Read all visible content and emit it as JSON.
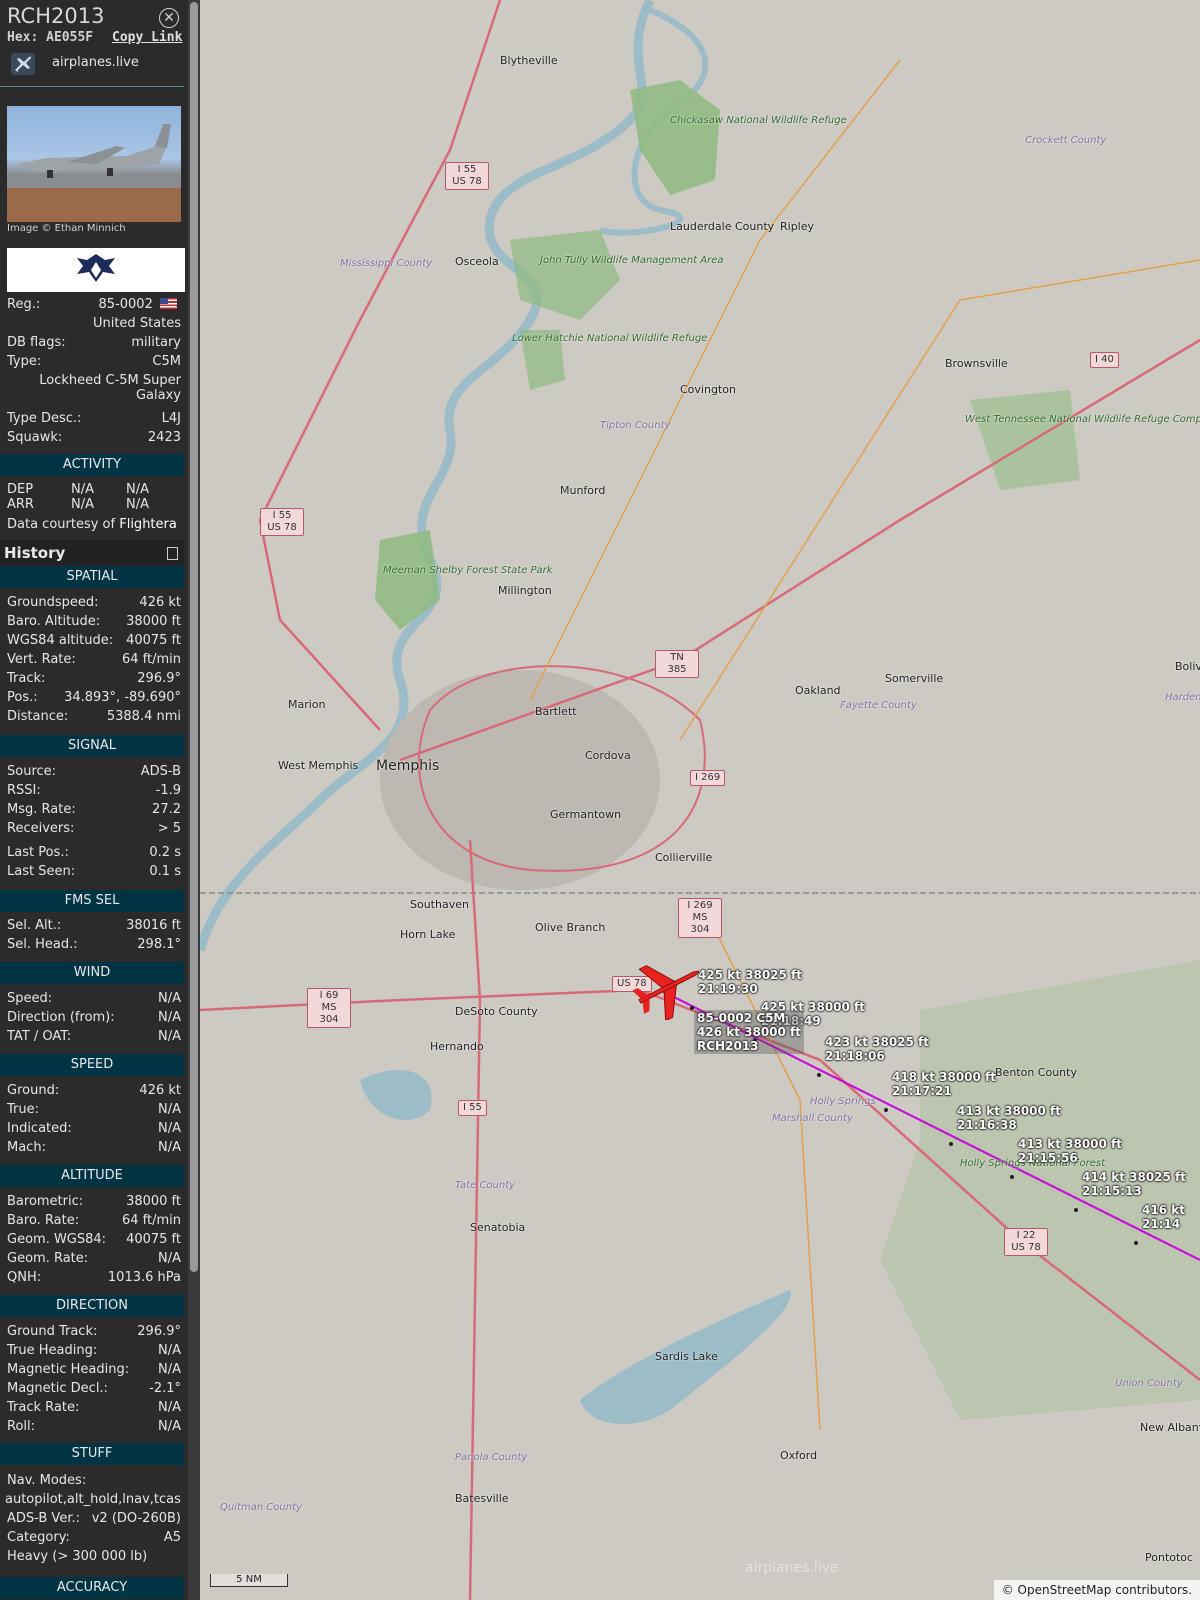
{
  "header": {
    "callsign": "RCH2013",
    "hex": "Hex: AE055F",
    "copy_link": "Copy Link",
    "site": "airplanes.live",
    "photo_credit": "Image © Ethan Minnich"
  },
  "aircraft": {
    "reg_label": "Reg.:",
    "reg_value": "85-0002",
    "country": "United States",
    "dbflags_label": "DB flags:",
    "dbflags_value": "military",
    "type_label": "Type:",
    "type_value": "C5M",
    "type_name_1": "Lockheed C-5M Super",
    "type_name_2": "Galaxy",
    "typedesc_label": "Type Desc.:",
    "typedesc_value": "L4J",
    "squawk_label": "Squawk:",
    "squawk_value": "2423"
  },
  "activity": {
    "title": "ACTIVITY",
    "dep_label": "DEP",
    "dep_1": "N/A",
    "dep_2": "N/A",
    "arr_label": "ARR",
    "arr_1": "N/A",
    "arr_2": "N/A",
    "courtesy": "Data courtesy of",
    "provider": "Flightera"
  },
  "history_label": "History",
  "spatial": {
    "title": "SPATIAL",
    "rows": [
      {
        "k": "Groundspeed:",
        "v": "426 kt"
      },
      {
        "k": "Baro. Altitude:",
        "v": "38000 ft"
      },
      {
        "k": "WGS84 altitude:",
        "v": "40075 ft"
      },
      {
        "k": "Vert. Rate:",
        "v": "64 ft/min"
      },
      {
        "k": "Track:",
        "v": "296.9°"
      },
      {
        "k": "Pos.:",
        "v": "34.893°, -89.690°"
      },
      {
        "k": "Distance:",
        "v": "5388.4 nmi"
      }
    ]
  },
  "signal": {
    "title": "SIGNAL",
    "rows": [
      {
        "k": "Source:",
        "v": "ADS-B"
      },
      {
        "k": "RSSI:",
        "v": "-1.9"
      },
      {
        "k": "Msg. Rate:",
        "v": "27.2"
      },
      {
        "k": "Receivers:",
        "v": "> 5"
      },
      {
        "k": "Last Pos.:",
        "v": "0.2 s"
      },
      {
        "k": "Last Seen:",
        "v": "0.1 s"
      }
    ]
  },
  "fms": {
    "title": "FMS SEL",
    "rows": [
      {
        "k": "Sel. Alt.:",
        "v": "38016 ft"
      },
      {
        "k": "Sel. Head.:",
        "v": "298.1°"
      }
    ]
  },
  "wind": {
    "title": "WIND",
    "rows": [
      {
        "k": "Speed:",
        "v": "N/A"
      },
      {
        "k": "Direction (from):",
        "v": "N/A"
      },
      {
        "k": "TAT / OAT:",
        "v": "N/A"
      }
    ]
  },
  "speed": {
    "title": "SPEED",
    "rows": [
      {
        "k": "Ground:",
        "v": "426 kt"
      },
      {
        "k": "True:",
        "v": "N/A"
      },
      {
        "k": "Indicated:",
        "v": "N/A"
      },
      {
        "k": "Mach:",
        "v": "N/A"
      }
    ]
  },
  "altitude": {
    "title": "ALTITUDE",
    "rows": [
      {
        "k": "Barometric:",
        "v": "38000 ft"
      },
      {
        "k": "Baro. Rate:",
        "v": "64 ft/min"
      },
      {
        "k": "Geom. WGS84:",
        "v": "40075 ft"
      },
      {
        "k": "Geom. Rate:",
        "v": "N/A"
      },
      {
        "k": "QNH:",
        "v": "1013.6 hPa"
      }
    ]
  },
  "direction": {
    "title": "DIRECTION",
    "rows": [
      {
        "k": "Ground Track:",
        "v": "296.9°"
      },
      {
        "k": "True Heading:",
        "v": "N/A"
      },
      {
        "k": "Magnetic Heading:",
        "v": "N/A"
      },
      {
        "k": "Magnetic Decl.:",
        "v": "-2.1°"
      },
      {
        "k": "Track Rate:",
        "v": "N/A"
      },
      {
        "k": "Roll:",
        "v": "N/A"
      }
    ]
  },
  "stuff": {
    "title": "STUFF",
    "nav_label": "Nav. Modes:",
    "nav_value": "autopilot,alt_hold,lnav,tcas",
    "adsb_label": "ADS-B Ver.:",
    "adsb_value": "v2 (DO-260B)",
    "cat_label": "Category:",
    "cat_value": "A5",
    "heavy": "Heavy (> 300 000 lb)"
  },
  "accuracy_title": "ACCURACY",
  "map": {
    "scale": "5 NM",
    "attribution": "© OpenStreetMap contributors.",
    "watermark": "airplanes.live",
    "colors": {
      "track": "#c800dc",
      "aircraft": "#e8231f",
      "land": "#cdc9c3",
      "water": "#9cbcc8",
      "park": "#8fbb80"
    },
    "places": [
      "Blytheville",
      "Osceola",
      "Mississippi County",
      "Chickasaw National Wildlife Refuge",
      "Lauderdale County",
      "Ripley",
      "Crockett County",
      "John Tully Wildlife Management Area",
      "Lower Hatchie National Wildlife Refuge",
      "Covington",
      "Brownsville",
      "Tipton County",
      "West Tennessee National Wildlife Refuge Complex",
      "Munford",
      "Meeman Shelby Forest State Park",
      "Millington",
      "Marion",
      "Bartlett",
      "Oakland",
      "Somerville",
      "Fayette County",
      "West Memphis",
      "Memphis",
      "Cordova",
      "Germantown",
      "Collierville",
      "Southaven",
      "Horn Lake",
      "Olive Branch",
      "DeSoto County",
      "Hernando",
      "Holly Springs",
      "Marshall County",
      "Benton County",
      "Holly Springs National Forest",
      "Tate County",
      "Senatobia",
      "Sardis Lake",
      "Panola County",
      "Batesville",
      "Quitman County",
      "Oxford",
      "Union County",
      "New Albany",
      "Pontotoc",
      "Bolivar",
      "Hardeman County"
    ],
    "shields": [
      "I 55 US 78",
      "I 55 US 78",
      "I 40",
      "TN 385",
      "I 269",
      "I 269 MS 304",
      "US 78",
      "I 69 MS 304",
      "I 55",
      "I 22 US 78"
    ],
    "aircraft_label": {
      "reg_type": "85-0002 C5M",
      "speed_alt": "426 kt  38000 ft",
      "callsign": "RCH2013"
    },
    "track_points": [
      {
        "speed_alt": "425 kt  38025 ft",
        "time": "21:19:30"
      },
      {
        "speed_alt": "425 kt  38000 ft",
        "time": "21:18:49"
      },
      {
        "speed_alt": "423 kt  38025 ft",
        "time": "21:18:06"
      },
      {
        "speed_alt": "418 kt  38000 ft",
        "time": "21:17:21"
      },
      {
        "speed_alt": "413 kt  38000 ft",
        "time": "21:16:38"
      },
      {
        "speed_alt": "413 kt  38000 ft",
        "time": "21:15:56"
      },
      {
        "speed_alt": "414 kt  38025 ft",
        "time": "21:15:13"
      },
      {
        "speed_alt": "416 kt",
        "time": "21:14"
      }
    ]
  }
}
